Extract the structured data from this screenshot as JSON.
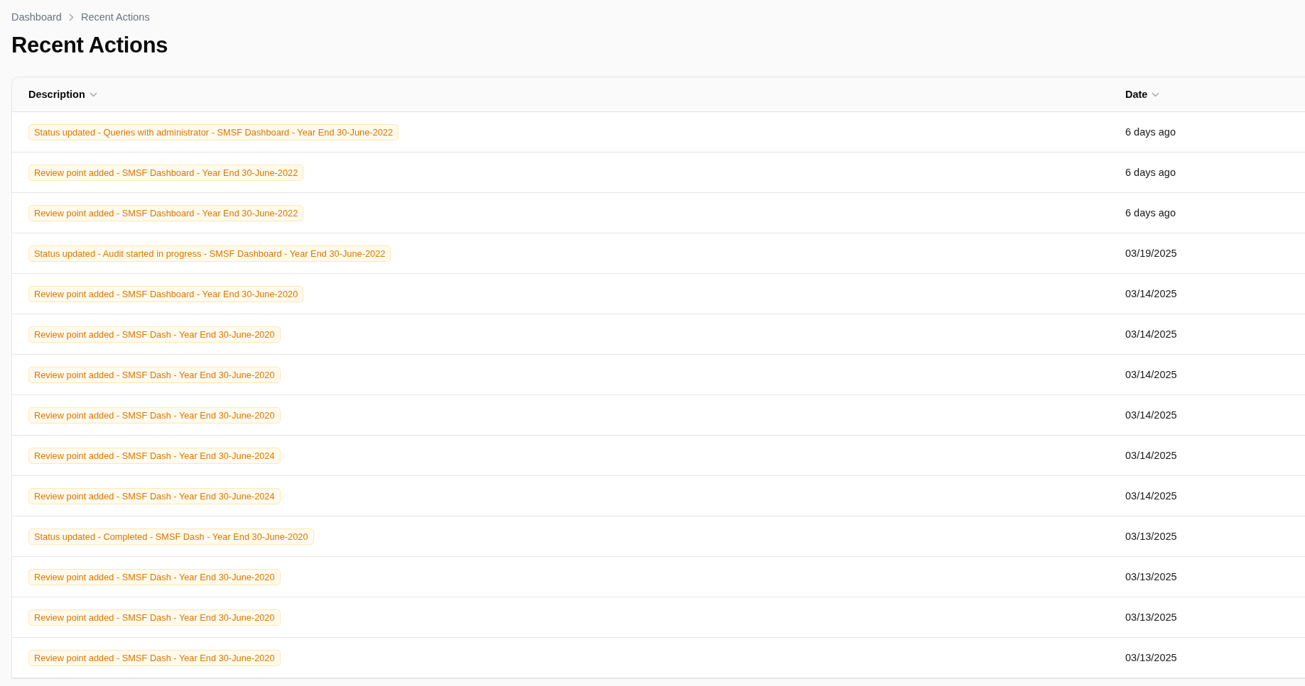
{
  "breadcrumb": [
    "Dashboard",
    "Recent Actions"
  ],
  "title": "Recent Actions",
  "table": {
    "columns": [
      "Description",
      "Date"
    ],
    "rows": [
      {
        "description": "Status updated - Queries with administrator - SMSF Dashboard - Year End 30-June-2022",
        "date": "6 days ago"
      },
      {
        "description": "Review point added - SMSF Dashboard - Year End 30-June-2022",
        "date": "6 days ago"
      },
      {
        "description": "Review point added - SMSF Dashboard - Year End 30-June-2022",
        "date": "6 days ago"
      },
      {
        "description": "Status updated - Audit started in progress - SMSF Dashboard - Year End 30-June-2022",
        "date": "03/19/2025"
      },
      {
        "description": "Review point added - SMSF Dashboard - Year End 30-June-2020",
        "date": "03/14/2025"
      },
      {
        "description": "Review point added - SMSF Dash - Year End 30-June-2020",
        "date": "03/14/2025"
      },
      {
        "description": "Review point added - SMSF Dash - Year End 30-June-2020",
        "date": "03/14/2025"
      },
      {
        "description": "Review point added - SMSF Dash - Year End 30-June-2020",
        "date": "03/14/2025"
      },
      {
        "description": "Review point added - SMSF Dash - Year End 30-June-2024",
        "date": "03/14/2025"
      },
      {
        "description": "Review point added - SMSF Dash - Year End 30-June-2024",
        "date": "03/14/2025"
      },
      {
        "description": "Status updated - Completed - SMSF Dash - Year End 30-June-2020",
        "date": "03/13/2025"
      },
      {
        "description": "Review point added - SMSF Dash - Year End 30-June-2020",
        "date": "03/13/2025"
      },
      {
        "description": "Review point added - SMSF Dash - Year End 30-June-2020",
        "date": "03/13/2025"
      },
      {
        "description": "Review point added - SMSF Dash - Year End 30-June-2020",
        "date": "03/13/2025"
      }
    ]
  }
}
